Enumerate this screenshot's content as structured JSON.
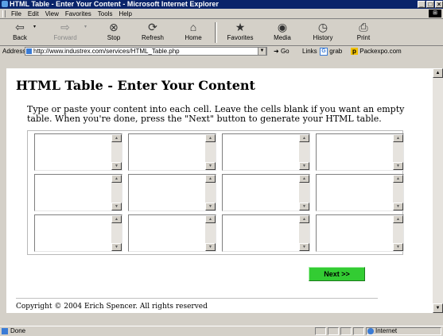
{
  "window": {
    "title": "HTML Table - Enter Your Content - Microsoft Internet Explorer"
  },
  "menu": [
    "File",
    "Edit",
    "View",
    "Favorites",
    "Tools",
    "Help"
  ],
  "toolbar": {
    "back": "Back",
    "forward": "Forward",
    "stop": "Stop",
    "refresh": "Refresh",
    "home": "Home",
    "favorites": "Favorites",
    "media": "Media",
    "history": "History",
    "print": "Print",
    "icons": {
      "back": "back-arrow-icon",
      "forward": "forward-arrow-icon",
      "stop": "stop-icon",
      "refresh": "refresh-icon",
      "home": "home-icon",
      "favorites": "favorites-icon",
      "media": "media-icon",
      "history": "history-icon",
      "print": "print-icon"
    }
  },
  "address": {
    "label": "Address",
    "url": "http://www.industrex.com/services/HTML_Table.php",
    "go": "Go",
    "links_label": "Links",
    "link_grab": "grab",
    "link_packexpo": "Packexpo.com"
  },
  "page": {
    "heading": "HTML Table - Enter Your Content",
    "intro": "Type or paste your content into each cell. Leave the cells blank if you want an empty table. When you're done, press the \"Next\" button to generate your HTML table.",
    "cells": [
      [
        "",
        "",
        "",
        ""
      ],
      [
        "",
        "",
        "",
        ""
      ],
      [
        "",
        "",
        "",
        ""
      ]
    ],
    "next_button": "Next >>",
    "copyright": "Copyright © 2004 Erich Spencer. All rights reserved"
  },
  "status": {
    "text": "Done",
    "zone": "Internet"
  },
  "colors": {
    "title_bar": "#0a246a",
    "next_button": "#33cc33",
    "chrome": "#d4d0c8"
  }
}
